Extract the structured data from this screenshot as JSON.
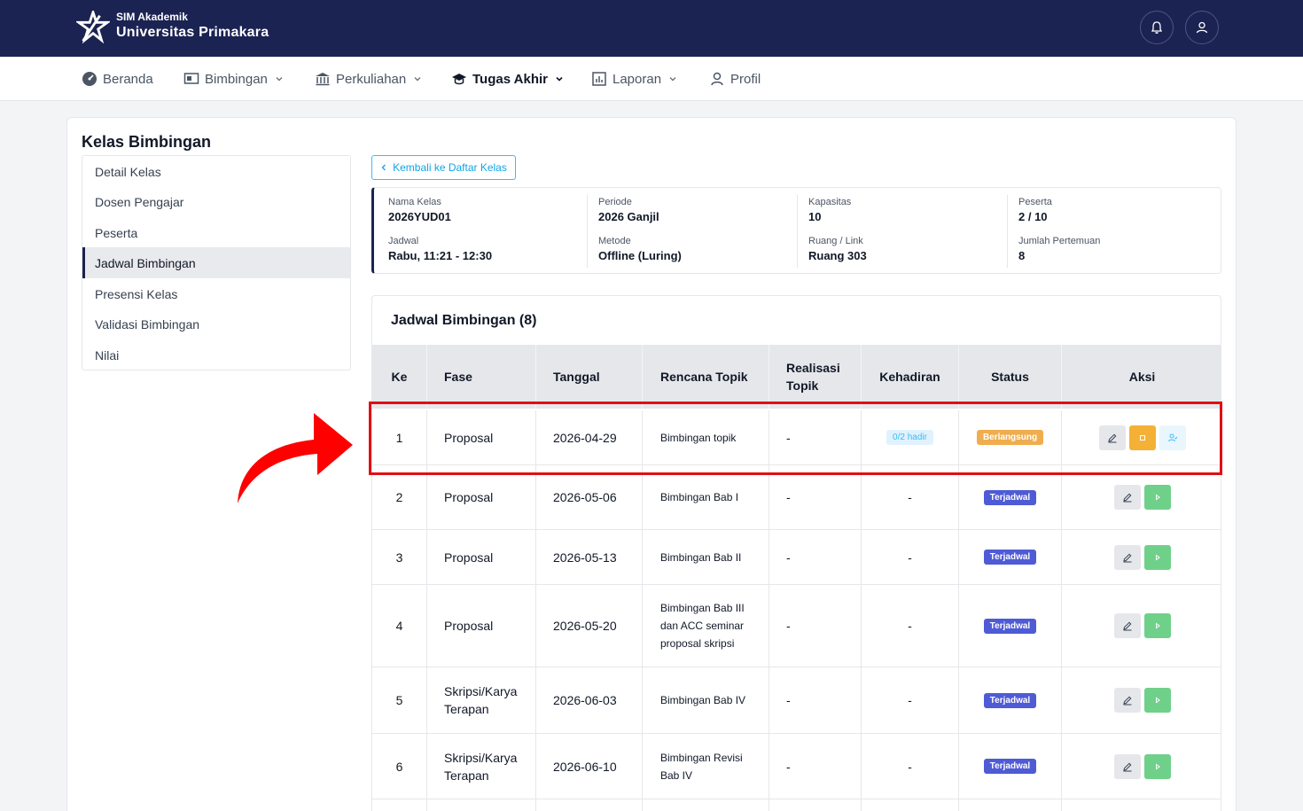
{
  "header": {
    "app_subtitle": "SIM Akademik",
    "app_title": "Universitas Primakara",
    "notification_icon": "bell-icon",
    "profile_icon": "user-icon",
    "bg_color": "#1b2352"
  },
  "nav": {
    "items": [
      {
        "label": "Beranda",
        "icon": "dashboard-icon"
      },
      {
        "label": "Bimbingan",
        "icon": "board-icon"
      },
      {
        "label": "Perkuliahan",
        "icon": "building-icon"
      },
      {
        "label": "Tugas Akhir",
        "icon": "graduation-cap-icon",
        "active": true
      },
      {
        "label": "Laporan",
        "icon": "report-icon"
      },
      {
        "label": "Profil",
        "icon": "user-icon"
      }
    ]
  },
  "page": {
    "title": "Kelas Bimbingan",
    "back_label": "Kembali ke Daftar Kelas"
  },
  "sidebar": {
    "items": [
      {
        "label": "Detail Kelas"
      },
      {
        "label": "Dosen Pengajar"
      },
      {
        "label": "Peserta"
      },
      {
        "label": "Jadwal Bimbingan",
        "active": true
      },
      {
        "label": "Presensi Kelas"
      },
      {
        "label": "Validasi Bimbingan"
      },
      {
        "label": "Nilai"
      }
    ]
  },
  "info": {
    "nama_kelas": {
      "label": "Nama Kelas",
      "value": "2026YUD01"
    },
    "periode": {
      "label": "Periode",
      "value": "2026 Ganjil"
    },
    "kapasitas": {
      "label": "Kapasitas",
      "value": "10"
    },
    "peserta": {
      "label": "Peserta",
      "value": "2 / 10"
    },
    "jadwal": {
      "label": "Jadwal",
      "value": "Rabu, 11:21 - 12:30"
    },
    "metode": {
      "label": "Metode",
      "value": "Offline (Luring)"
    },
    "ruang": {
      "label": "Ruang / Link",
      "value": "Ruang 303"
    },
    "jumlah": {
      "label": "Jumlah Pertemuan",
      "value": "8"
    }
  },
  "schedule": {
    "title": "Jadwal Bimbingan (8)",
    "columns": {
      "ke": "Ke",
      "fase": "Fase",
      "tanggal": "Tanggal",
      "rencana": "Rencana Topik",
      "realisasi": "Realisasi Topik",
      "kehadiran": "Kehadiran",
      "status": "Status",
      "aksi": "Aksi"
    },
    "rows": [
      {
        "ke": "1",
        "fase": "Proposal",
        "tanggal": "2026-04-29",
        "rencana": "Bimbingan topik",
        "realisasi": "-",
        "kehadiran": "0/2 hadir",
        "status": "Berlangsung"
      },
      {
        "ke": "2",
        "fase": "Proposal",
        "tanggal": "2026-05-06",
        "rencana": "Bimbingan Bab I",
        "realisasi": "-",
        "kehadiran": "-",
        "status": "Terjadwal"
      },
      {
        "ke": "3",
        "fase": "Proposal",
        "tanggal": "2026-05-13",
        "rencana": "Bimbingan Bab II",
        "realisasi": "-",
        "kehadiran": "-",
        "status": "Terjadwal"
      },
      {
        "ke": "4",
        "fase": "Proposal",
        "tanggal": "2026-05-20",
        "rencana": "Bimbingan Bab III dan ACC seminar proposal skripsi",
        "realisasi": "-",
        "kehadiran": "-",
        "status": "Terjadwal"
      },
      {
        "ke": "5",
        "fase": "Skripsi/Karya Terapan",
        "tanggal": "2026-06-03",
        "rencana": "Bimbingan Bab IV",
        "realisasi": "-",
        "kehadiran": "-",
        "status": "Terjadwal"
      },
      {
        "ke": "6",
        "fase": "Skripsi/Karya Terapan",
        "tanggal": "2026-06-10",
        "rencana": "Bimbingan Revisi Bab IV",
        "realisasi": "-",
        "kehadiran": "-",
        "status": "Terjadwal"
      }
    ]
  },
  "colors": {
    "status_berlangsung": "#f0ad4e",
    "status_terjadwal": "#4f5bd5",
    "highlight": "#e10f14",
    "arrow": "#ff0000"
  }
}
